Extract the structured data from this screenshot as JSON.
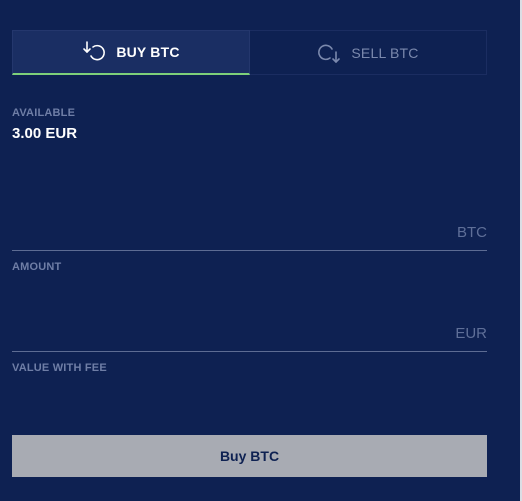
{
  "tabs": {
    "buy_label": "BUY BTC",
    "sell_label": "SELL BTC"
  },
  "available": {
    "label": "AVAILABLE",
    "value": "3.00 EUR"
  },
  "amount": {
    "unit": "BTC",
    "label": "AMOUNT",
    "value": ""
  },
  "value_with_fee": {
    "unit": "EUR",
    "label": "VALUE WITH FEE",
    "value": ""
  },
  "buy_button_label": "Buy BTC",
  "colors": {
    "background": "#0e2152",
    "active_tab_indicator": "#7ed07a",
    "button_background": "#a8abb3"
  },
  "icons": {
    "buy_tab": "buy-arrow-circle-icon",
    "sell_tab": "sell-arrow-circle-icon"
  }
}
